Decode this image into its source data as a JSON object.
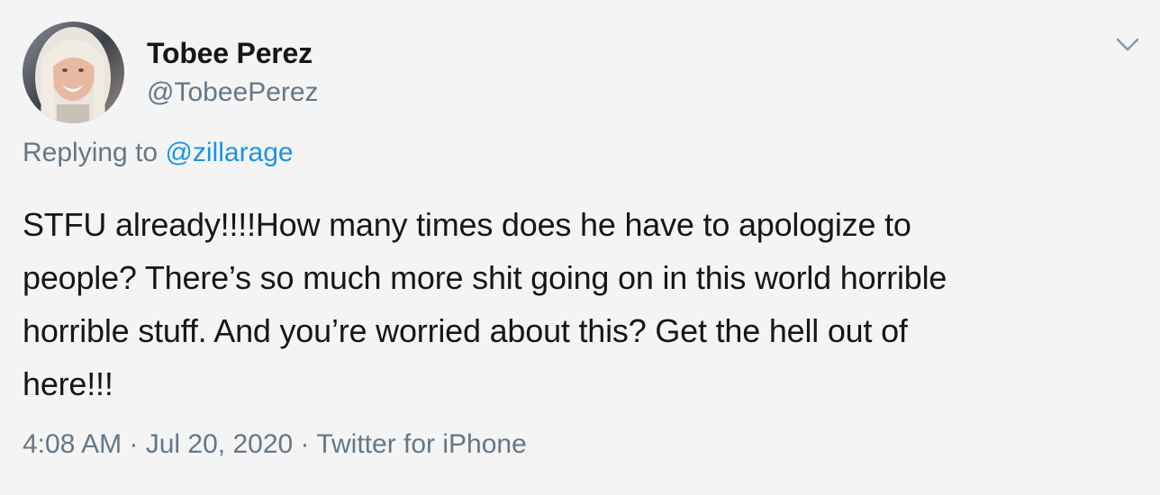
{
  "author": {
    "display_name": "Tobee Perez",
    "handle": "@TobeePerez"
  },
  "reply": {
    "prefix": "Replying to ",
    "mention": "@zillarage"
  },
  "tweet": {
    "text": "STFU already!!!!How many times does he have to apologize to\npeople? There’s so much more shit going on in this world horrible\nhorrible stuff. And you’re worried about this? Get the hell out of\nhere!!!"
  },
  "meta": {
    "time": "4:08 AM",
    "separator1": " · ",
    "date": "Jul 20, 2020",
    "separator2": " · ",
    "source": "Twitter for iPhone"
  },
  "icons": {
    "menu": "chevron-down-icon",
    "avatar": "avatar"
  },
  "colors": {
    "background": "#f4f4f5",
    "text_primary": "#14171a",
    "text_secondary": "#657786",
    "link": "#1b95e0"
  }
}
